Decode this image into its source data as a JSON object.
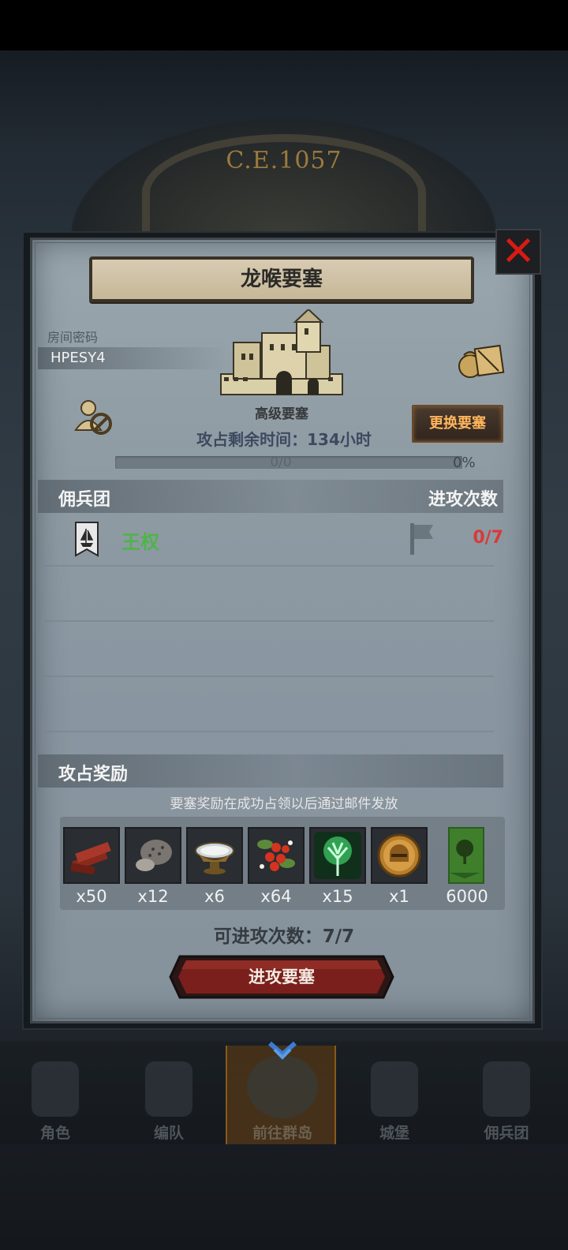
{
  "background": {
    "era_label": "C.E.1057"
  },
  "dialog": {
    "title": "龙喉要塞",
    "close_icon": "close-x-icon",
    "room_password_label": "房间密码",
    "room_password_value": "HPESY4",
    "fortress_level": "高级要塞",
    "change_fortress_button": "更换要塞",
    "time_left": "攻占剩余时间：134小时",
    "progress": {
      "text": "0/0",
      "percent_label": "0%",
      "fraction": 0
    },
    "mercenary_section": {
      "title": "佣兵团",
      "right_title": "进攻次数",
      "rows": [
        {
          "name": "王权",
          "attacks": "0/7",
          "name_color": "#4fb44a",
          "attacks_color": "#d9393a"
        }
      ]
    },
    "reward_section": {
      "title": "攻占奖励",
      "hint": "要塞奖励在成功占领以后通过邮件发放",
      "items": [
        {
          "icon": "wood-planks-icon",
          "count": "x50"
        },
        {
          "icon": "ore-rock-icon",
          "count": "x12"
        },
        {
          "icon": "silver-bowl-icon",
          "count": "x6"
        },
        {
          "icon": "berries-icon",
          "count": "x64"
        },
        {
          "icon": "green-tree-spirit-icon",
          "count": "x15"
        },
        {
          "icon": "golden-helmet-coin-icon",
          "count": "x1"
        },
        {
          "icon": "green-guild-banner-icon",
          "count": "6000"
        }
      ]
    },
    "attempts_label": "可进攻次数：7/7",
    "attack_button": "进攻要塞"
  },
  "bottom_nav": {
    "items": [
      {
        "label": "角色",
        "icon": "knight-icon",
        "active": false
      },
      {
        "label": "编队",
        "icon": "helmet-icon",
        "active": false
      },
      {
        "label": "前往群岛",
        "icon": "globe-icon",
        "active": true
      },
      {
        "label": "城堡",
        "icon": "castle-icon",
        "active": false
      },
      {
        "label": "佣兵团",
        "icon": "mercenary-icon",
        "active": false
      }
    ]
  },
  "colors": {
    "accent_orange": "#ffb65c",
    "close_red": "#d91a12",
    "attack_red": "#7a1f1c"
  }
}
